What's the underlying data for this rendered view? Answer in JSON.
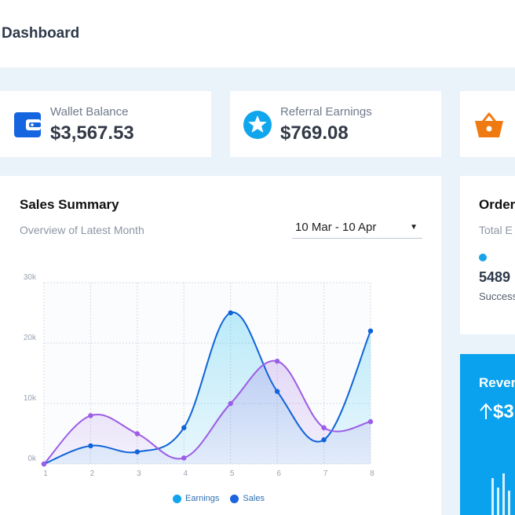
{
  "page": {
    "title": "Dashboard"
  },
  "stats": [
    {
      "label": "Wallet Balance",
      "value": "$3,567.53",
      "icon": "wallet-icon",
      "color": "#1565e0"
    },
    {
      "label": "Referral Earnings",
      "value": "$769.08",
      "icon": "star-icon",
      "color": "#10a6ee"
    },
    {
      "label": "",
      "value": "",
      "icon": "basket-icon",
      "color": "#f07a12"
    }
  ],
  "sales_summary": {
    "title": "Sales Summary",
    "subtitle": "Overview of Latest Month",
    "date_range": "10 Mar - 10 Apr",
    "legend": [
      {
        "name": "Earnings",
        "color": "#12a4ee"
      },
      {
        "name": "Sales",
        "color": "#1b63e0"
      }
    ]
  },
  "orders": {
    "title": "Order",
    "subtitle": "Total E",
    "value": "5489",
    "status": "Success"
  },
  "revenue": {
    "title": "Rever",
    "value": "$3"
  },
  "chart_data": {
    "type": "area",
    "x": [
      1,
      2,
      3,
      4,
      5,
      6,
      7,
      8
    ],
    "y_ticks": [
      "0k",
      "10k",
      "20k",
      "30k"
    ],
    "ylim": [
      0,
      30000
    ],
    "grid": true,
    "legend_position": "bottom",
    "series": [
      {
        "name": "Earnings",
        "values": [
          0,
          8000,
          5000,
          1000,
          10000,
          17000,
          6000,
          7000
        ],
        "line_color": "#9b5de5"
      },
      {
        "name": "Sales",
        "values": [
          0,
          3000,
          2000,
          6000,
          25000,
          12000,
          4000,
          22000
        ],
        "line_color": "#0f63d8"
      }
    ]
  }
}
